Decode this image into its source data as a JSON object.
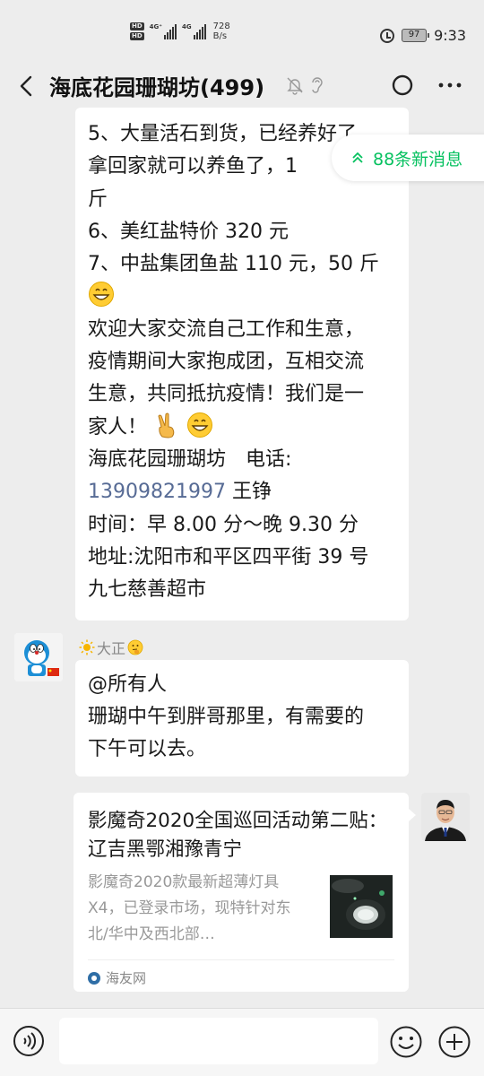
{
  "status_bar": {
    "hd1": "HD",
    "hd2": "HD",
    "net1": "4G⁺",
    "net2": "4G",
    "speed_value": "728",
    "speed_unit": "B/s",
    "battery": "97",
    "time": "9:33"
  },
  "header": {
    "title": "海底花园珊瑚坊(499)"
  },
  "new_messages": {
    "label": "88条新消息"
  },
  "message1": {
    "lines": [
      "5、大量活石到货，已经养好了",
      "拿回家就可以养鱼了，1",
      "斤",
      "6、美红盐特价 320 元",
      "7、中盐集团鱼盐 110 元，50 斤",
      "",
      "欢迎大家交流自己工作和生意，",
      "疫情期间大家抱成团，互相交流",
      "生意，共同抵抗疫情！我们是一",
      "家人！",
      "海底花园珊瑚坊　电话:",
      "13909821997",
      " 王铮",
      "时间：早 8.00 分～晚 9.30 分",
      "地址:沈阳市和平区四平街 39 号",
      "九七慈善超市"
    ]
  },
  "message2": {
    "sender": "大正",
    "lines": [
      "@所有人",
      "珊瑚中午到胖哥那里，有需要的",
      "下午可以去。"
    ]
  },
  "link_card": {
    "title": "影魔奇2020全国巡回活动第二贴：  辽吉黑鄂湘豫青宁",
    "description": "影魔奇2020款最新超薄灯具X4，已登录市场，现特针对东北/华中及西北部…",
    "source": "海友网"
  },
  "input_bar": {
    "placeholder": ""
  },
  "colors": {
    "accent_green": "#07c160",
    "link_blue": "#576b95",
    "background": "#ededed"
  },
  "icons": [
    "back-arrow-icon",
    "mute-bell-icon",
    "ear-icon",
    "circle-icon",
    "more-icon",
    "double-chevron-up-icon",
    "grin-emoji-icon",
    "victory-hand-icon",
    "sun-icon",
    "thinking-emoji-icon",
    "voice-icon",
    "emoji-icon",
    "plus-icon"
  ]
}
